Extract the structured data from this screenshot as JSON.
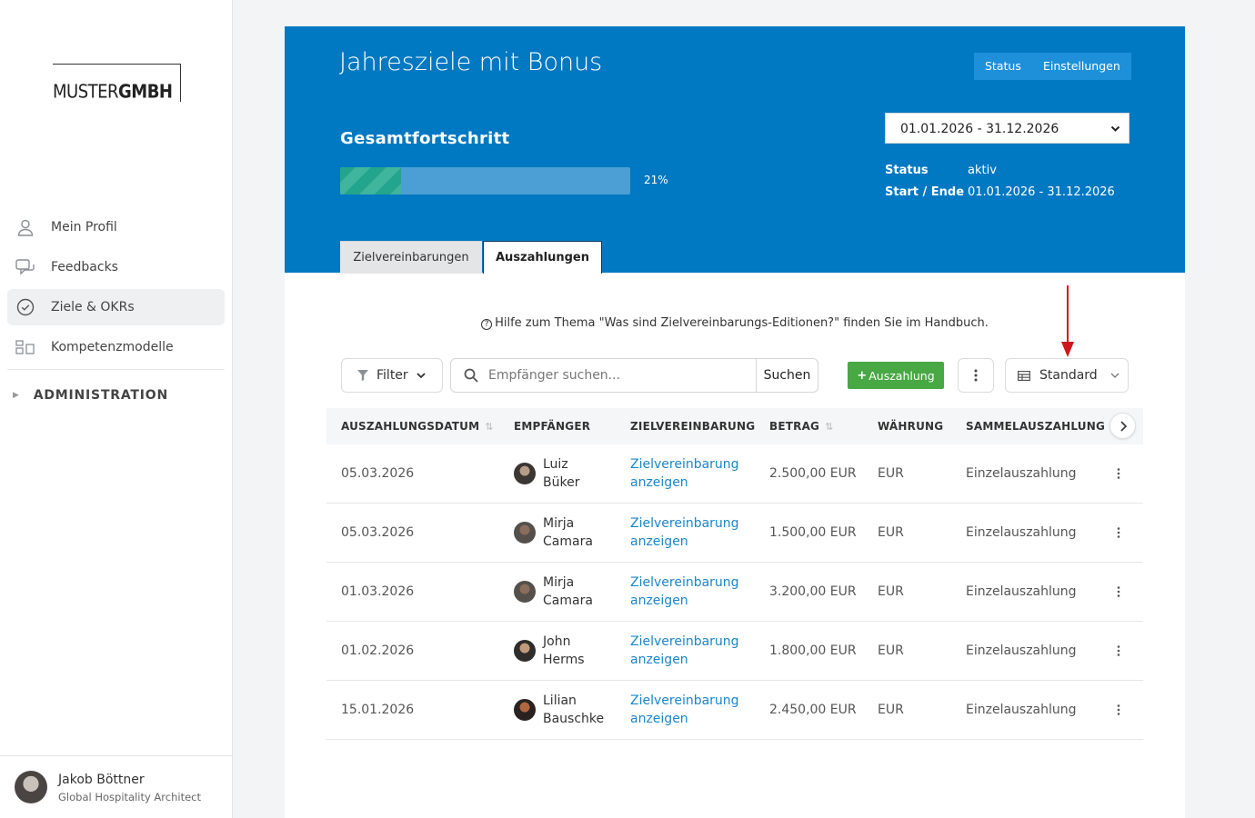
{
  "brand": {
    "logo_light": "MUSTER",
    "logo_bold": "GMBH"
  },
  "sidebar": {
    "items": [
      {
        "label": "Mein Profil",
        "icon": "user-icon",
        "active": false
      },
      {
        "label": "Feedbacks",
        "icon": "chat-icon",
        "active": false
      },
      {
        "label": "Ziele & OKRs",
        "icon": "check-circle-icon",
        "active": true
      },
      {
        "label": "Kompetenzmodelle",
        "icon": "grid-icon",
        "active": false
      }
    ],
    "admin_label": "ADMINISTRATION"
  },
  "user": {
    "name": "Jakob Böttner",
    "role": "Global Hospitality Architect"
  },
  "hero": {
    "title": "Jahresziele mit Bonus",
    "status_button": "Status",
    "settings_button": "Einstellungen",
    "progress_title": "Gesamtfortschritt",
    "progress_value": 21,
    "progress_label": "21%",
    "period": "01.01.2026 - 31.12.2026",
    "status_label": "Status",
    "status_value": "aktiv",
    "range_label": "Start / Ende",
    "range_value": "01.01.2026 - 31.12.2026",
    "tabs": [
      "Zielvereinbarungen",
      "Auszahlungen"
    ]
  },
  "help_text": "Hilfe zum Thema \"Was sind Zielvereinbarungs-Editionen?\" finden Sie im Handbuch.",
  "toolbar": {
    "filter_label": "Filter",
    "search_placeholder": "Empfänger suchen...",
    "search_button": "Suchen",
    "add_button": "Auszahlung",
    "view_label": "Standard"
  },
  "table": {
    "columns": [
      "AUSZAHLUNGSDATUM",
      "EMPFÄNGER",
      "ZIELVEREINBARUNG",
      "BETRAG",
      "WÄHRUNG",
      "SAMMELAUSZAHLUNG"
    ],
    "rows": [
      {
        "date": "05.03.2026",
        "first": "Luiz",
        "last": "Büker",
        "link1": "Zielvereinbarung",
        "link2": "anzeigen",
        "amount": "2.500,00 EUR",
        "currency": "EUR",
        "type": "Einzelauszahlung"
      },
      {
        "date": "05.03.2026",
        "first": "Mirja",
        "last": "Camara",
        "link1": "Zielvereinbarung",
        "link2": "anzeigen",
        "amount": "1.500,00 EUR",
        "currency": "EUR",
        "type": "Einzelauszahlung"
      },
      {
        "date": "01.03.2026",
        "first": "Mirja",
        "last": "Camara",
        "link1": "Zielvereinbarung",
        "link2": "anzeigen",
        "amount": "3.200,00 EUR",
        "currency": "EUR",
        "type": "Einzelauszahlung"
      },
      {
        "date": "01.02.2026",
        "first": "John",
        "last": "Herms",
        "link1": "Zielvereinbarung",
        "link2": "anzeigen",
        "amount": "1.800,00 EUR",
        "currency": "EUR",
        "type": "Einzelauszahlung"
      },
      {
        "date": "15.01.2026",
        "first": "Lilian",
        "last": "Bauschke",
        "link1": "Zielvereinbarung",
        "link2": "anzeigen",
        "amount": "2.450,00 EUR",
        "currency": "EUR",
        "type": "Einzelauszahlung"
      }
    ]
  },
  "colors": {
    "brand_blue": "#0178c2",
    "accent_green": "#48a844",
    "link_blue": "#1a86c8",
    "annotation_red": "#d0161c"
  }
}
